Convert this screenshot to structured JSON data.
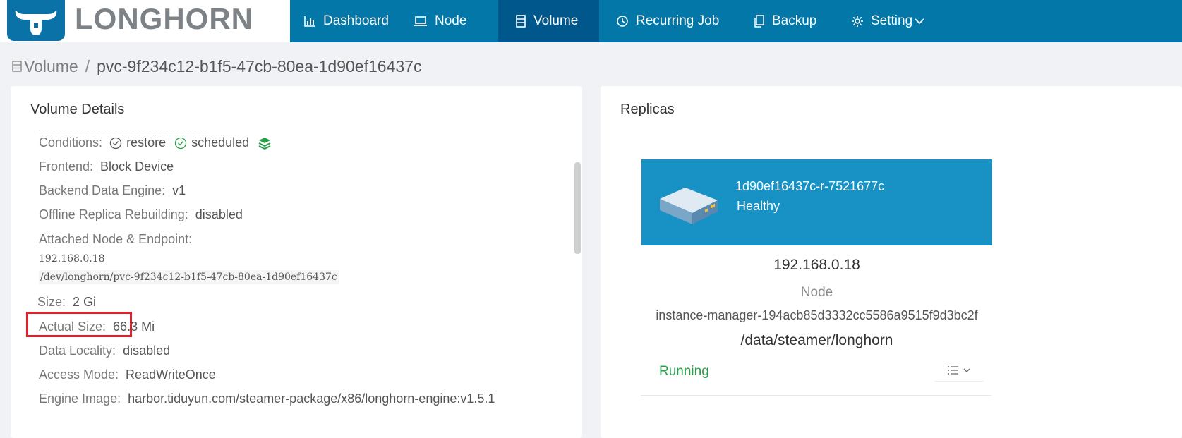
{
  "app": {
    "brand": "LONGHORN"
  },
  "nav": {
    "items": [
      {
        "label": "Dashboard",
        "icon": "bar-chart-icon"
      },
      {
        "label": "Node",
        "icon": "laptop-icon"
      },
      {
        "label": "Volume",
        "icon": "database-icon",
        "active": true
      },
      {
        "label": "Recurring Job",
        "icon": "clock-icon"
      },
      {
        "label": "Backup",
        "icon": "copy-icon"
      },
      {
        "label": "Setting",
        "icon": "gear-icon"
      }
    ]
  },
  "breadcrumb": {
    "parent": "Volume",
    "separator": "/",
    "current": "pvc-9f234c12-b1f5-47cb-80ea-1d90ef16437c"
  },
  "volume_details": {
    "title": "Volume Details",
    "conditions_label": "Conditions:",
    "conditions": [
      "restore",
      "scheduled"
    ],
    "frontend_label": "Frontend:",
    "frontend": "Block Device",
    "backend_label": "Backend Data Engine:",
    "backend": "v1",
    "offline_rebuild_label": "Offline Replica Rebuilding:",
    "offline_rebuild": "disabled",
    "attached_label": "Attached Node & Endpoint:",
    "attached_node": "192.168.0.18",
    "endpoint": "/dev/longhorn/pvc-9f234c12-b1f5-47cb-80ea-1d90ef16437c",
    "size_label": "Size:",
    "size": "2 Gi",
    "actual_size_label": "Actual Size:",
    "actual_size": "66.3 Mi",
    "data_locality_label": "Data Locality:",
    "data_locality": "disabled",
    "access_mode_label": "Access Mode:",
    "access_mode": "ReadWriteOnce",
    "engine_image_label": "Engine Image:",
    "engine_image": "harbor.tiduyun.com/steamer-package/x86/longhorn-engine:v1.5.1"
  },
  "replicas": {
    "title": "Replicas",
    "items": [
      {
        "name": "1d90ef16437c-r-7521677c",
        "health": "Healthy",
        "ip": "192.168.0.18",
        "node_label": "Node",
        "instance_manager": "instance-manager-194acb85d3332cc5586a9515f9d3bc2f",
        "path": "/data/steamer/longhorn",
        "state": "Running"
      }
    ]
  },
  "colors": {
    "topbar": "#0277a8",
    "nav_active": "#00578b",
    "replica_header": "#1892c5",
    "running": "#27a04a",
    "highlight": "#e0202a"
  }
}
